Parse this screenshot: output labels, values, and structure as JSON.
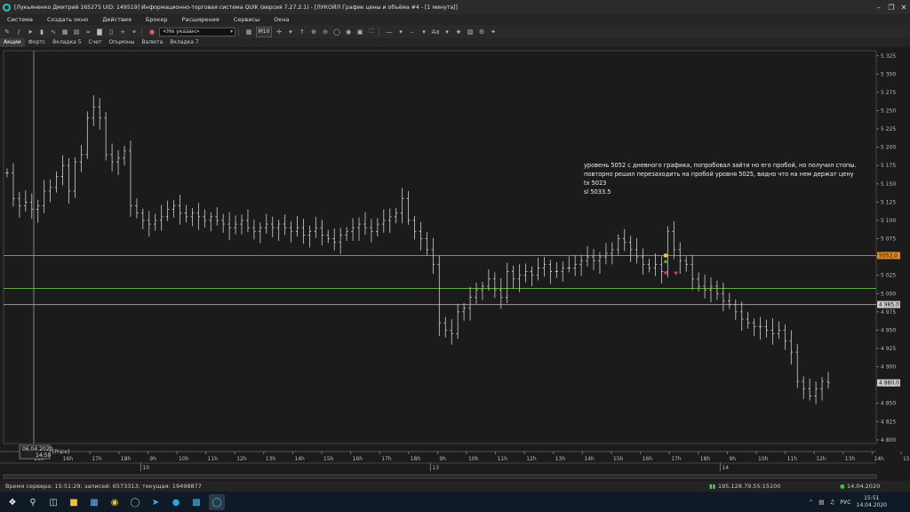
{
  "window": {
    "title": "[Лукьяненко Дмитрий 165275 UID: 149519] Информационно-торговая система QUIK (версия 7.27.2.1) - [ЛУКОЙЛ График цены и объёма #4 - [1 минута]]"
  },
  "menu": [
    "Система",
    "Создать окно",
    "Действия",
    "Брокер",
    "Расширения",
    "Сервисы",
    "Окна"
  ],
  "toolbar": {
    "instrument": "<Не указан>",
    "timeframe": "M10",
    "font_label": "Aa"
  },
  "tabs": [
    "Акции",
    "Фортс",
    "Вкладка 5",
    "Счет",
    "Опционы",
    "Валюта",
    "Вкладка 7"
  ],
  "annotation": {
    "line1": "уровень 5052 с дневного графика, попробовал зайти но его пробой, но получил стопы.",
    "line2": "повторно решил перезаходить на пробой уровня 5025, видно что на нем держат цену",
    "line3": "tx 5023",
    "line4": "sl 5033.5"
  },
  "crosshair": {
    "date_label": "06.04.2020",
    "time_label": "14:50",
    "series_label": "[Price]"
  },
  "price_labels": {
    "level_5052": "5052,0",
    "level_4985": "4 985,0",
    "last_price": "4 880,0"
  },
  "status": {
    "server_time": "Время сервера: 15:51:29; записей: 6573313; текущая: 19498877",
    "connection": "195.128.79.55:15100",
    "date": "14.04.2020"
  },
  "taskbar": {
    "lang": "РУС",
    "time": "15:51",
    "date": "14.04.2020"
  },
  "chart_data": {
    "type": "bar",
    "title": "ЛУКОЙЛ График цены и объёма #4 - [1 минута]",
    "y_ticks": [
      4800,
      4825,
      4850,
      4875,
      4900,
      4925,
      4950,
      4975,
      5000,
      5025,
      5050,
      5075,
      5100,
      5125,
      5150,
      5175,
      5200,
      5225,
      5250,
      5275,
      5300,
      5325
    ],
    "y_tick_labels": [
      "4 800",
      "4 825",
      "4 850",
      "4 875",
      "4 900",
      "4 925",
      "4 950",
      "4 975",
      "5 000",
      "5 025",
      "5 050",
      "5 075",
      "5 100",
      "5 125",
      "5 150",
      "5 175",
      "5 200",
      "5 225",
      "5 250",
      "5 275",
      "5 300",
      "5 325"
    ],
    "ylim": [
      4795,
      5332
    ],
    "x_ticks": [
      "15h",
      "16h",
      "17h",
      "18h",
      "9h",
      "10h",
      "11h",
      "12h",
      "13h",
      "14h",
      "15h",
      "16h",
      "17h",
      "18h",
      "9h",
      "10h",
      "11h",
      "12h",
      "13h",
      "14h",
      "15h",
      "16h",
      "17h",
      "18h",
      "9h",
      "10h",
      "11h",
      "12h",
      "13h",
      "14h",
      "15h"
    ],
    "day_labels": [
      {
        "label": "10",
        "tick_index": 4
      },
      {
        "label": "13",
        "tick_index": 14
      },
      {
        "label": "14",
        "tick_index": 24
      }
    ],
    "levels": [
      {
        "name": "level-5052",
        "value": 5052,
        "color": "#d98a2b"
      },
      {
        "name": "level-5007",
        "value": 5007,
        "color": "#5cae3a"
      },
      {
        "name": "level-4985",
        "value": 4985,
        "color": "#9a9a9a"
      }
    ],
    "closes": [
      5165,
      5130,
      5120,
      5125,
      5115,
      5120,
      5140,
      5145,
      5160,
      5175,
      5140,
      5180,
      5190,
      5240,
      5255,
      5240,
      5190,
      5180,
      5185,
      5195,
      5120,
      5110,
      5100,
      5095,
      5100,
      5105,
      5115,
      5120,
      5110,
      5105,
      5110,
      5105,
      5100,
      5105,
      5100,
      5095,
      5090,
      5095,
      5100,
      5090,
      5085,
      5090,
      5095,
      5090,
      5095,
      5090,
      5085,
      5090,
      5080,
      5085,
      5090,
      5080,
      5075,
      5070,
      5080,
      5085,
      5090,
      5095,
      5090,
      5085,
      5095,
      5100,
      5105,
      5110,
      5130,
      5100,
      5085,
      5075,
      5060,
      5040,
      4960,
      4950,
      4945,
      4975,
      4980,
      4995,
      5005,
      5010,
      5020,
      5005,
      4995,
      5030,
      5020,
      5025,
      5030,
      5025,
      5035,
      5040,
      5030,
      5030,
      5035,
      5035,
      5040,
      5045,
      5050,
      5045,
      5050,
      5055,
      5060,
      5075,
      5070,
      5060,
      5050,
      5040,
      5035,
      5040,
      5030,
      5085,
      5060,
      5045,
      5040,
      5020,
      5010,
      5005,
      5010,
      5000,
      4990,
      4985,
      4975,
      4965,
      4960,
      4955,
      4955,
      4950,
      4945,
      4950,
      4935,
      4920,
      4880,
      4870,
      4860,
      4870,
      4880,
      4878
    ]
  }
}
